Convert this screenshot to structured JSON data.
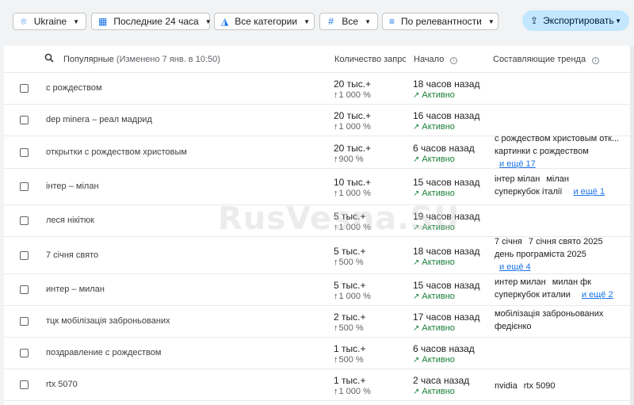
{
  "filters": {
    "region": "Ukraine",
    "period": "Последние 24 часа",
    "category": "Все категории",
    "type": "Все",
    "sort": "По релевантности"
  },
  "export_label": "Экспортировать",
  "header": {
    "title": "Популярные",
    "subtitle": "(Изменено 7 янв. в 10:50)",
    "col_volume": "Количество запросов",
    "col_start": "Начало",
    "col_components": "Составляющие тренда"
  },
  "rows": [
    {
      "term": "с рождеством",
      "volume": "20 тыс.+",
      "change": "1 000 %",
      "started": "18 часов назад",
      "status": "Активно",
      "components": []
    },
    {
      "term": "dep minera – реал мадрид",
      "volume": "20 тыс.+",
      "change": "1 000 %",
      "started": "16 часов назад",
      "status": "Активно",
      "components": []
    },
    {
      "term": "открытки с рождеством христовым",
      "volume": "20 тыс.+",
      "change": "900 %",
      "started": "6 часов назад",
      "status": "Активно",
      "components": [
        "с рождеством христовым отк...",
        "картинки с рождеством"
      ],
      "more": "и ещё 17"
    },
    {
      "term": "інтер – мілан",
      "volume": "10 тыс.+",
      "change": "1 000 %",
      "started": "15 часов назад",
      "status": "Активно",
      "components": [
        "інтер мілан",
        "мілан",
        "суперкубок італії"
      ],
      "more": "и ещё 1"
    },
    {
      "term": "леся нікітюк",
      "volume": "5 тыс.+",
      "change": "1 000 %",
      "started": "19 часов назад",
      "status": "Активно",
      "components": []
    },
    {
      "term": "7 січня свято",
      "volume": "5 тыс.+",
      "change": "500 %",
      "started": "18 часов назад",
      "status": "Активно",
      "components": [
        "7 січня",
        "7 січня свято 2025",
        "день програміста 2025"
      ],
      "more": "и ещё 4"
    },
    {
      "term": "интер – милан",
      "volume": "5 тыс.+",
      "change": "1 000 %",
      "started": "15 часов назад",
      "status": "Активно",
      "components": [
        "интер милан",
        "милан фк",
        "суперкубок италии"
      ],
      "more": "и ещё 2"
    },
    {
      "term": "тцк мобілізація заброньованих",
      "volume": "2 тыс.+",
      "change": "500 %",
      "started": "17 часов назад",
      "status": "Активно",
      "components": [
        "мобілізація заброньованих",
        "федієнко"
      ]
    },
    {
      "term": "поздравление с рождеством",
      "volume": "1 тыс.+",
      "change": "500 %",
      "started": "6 часов назад",
      "status": "Активно",
      "components": []
    },
    {
      "term": "rtx 5070",
      "volume": "1 тыс.+",
      "change": "1 000 %",
      "started": "2 часа назад",
      "status": "Активно",
      "components": [
        "nvidia",
        "rtx 5090"
      ]
    }
  ],
  "watermark": "RusVesna.SU",
  "colors": {
    "accent": "#1a73e8",
    "active": "#188038",
    "export_bg": "#c2e7ff"
  }
}
